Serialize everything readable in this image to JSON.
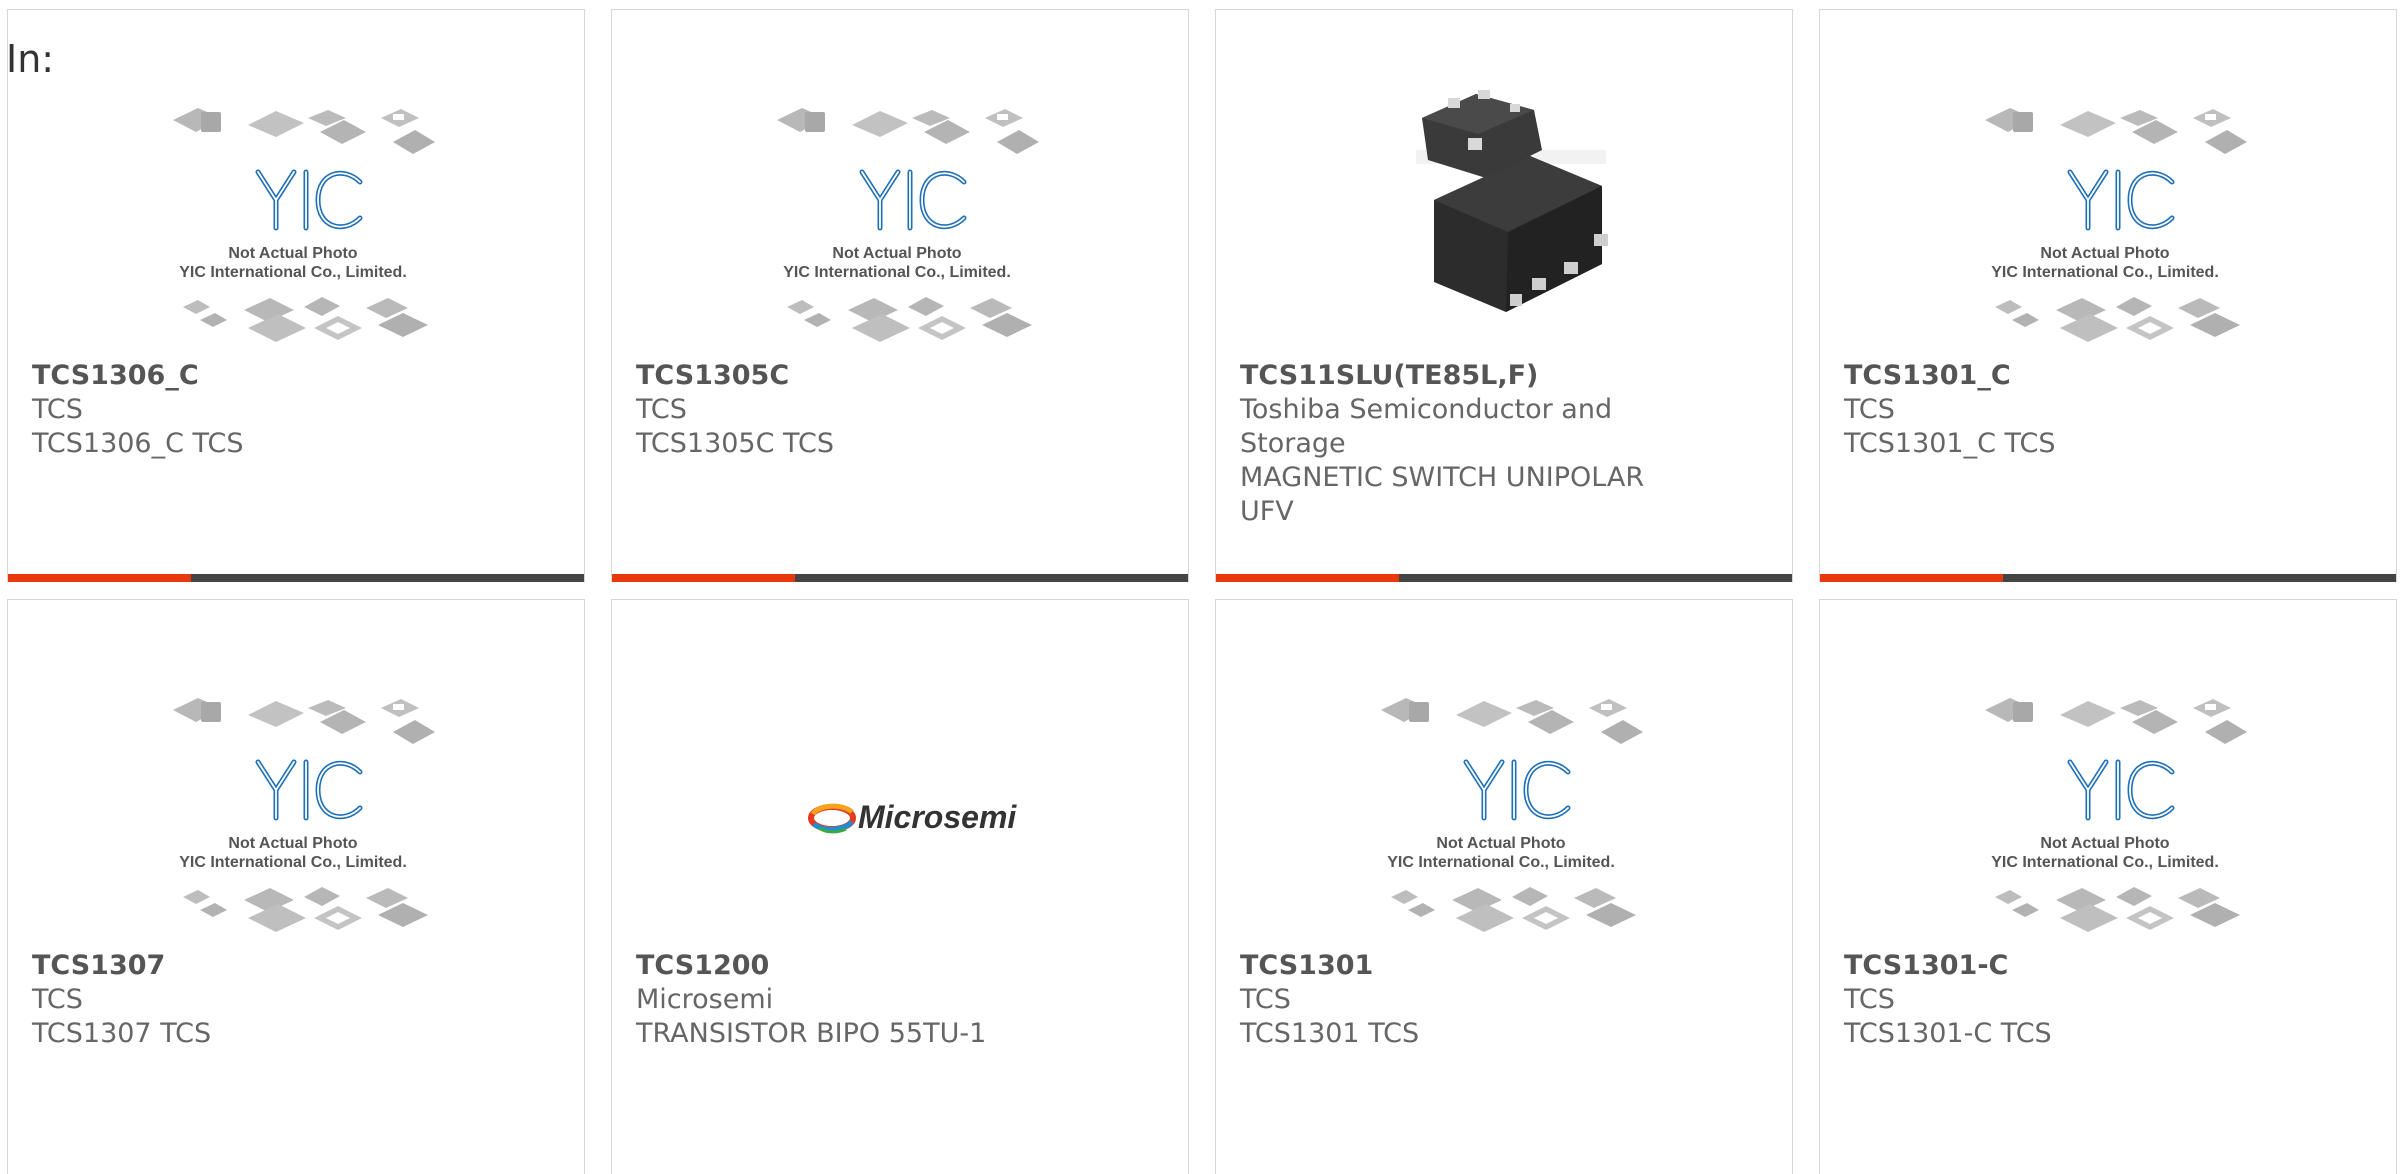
{
  "header": {
    "in_label": "In:"
  },
  "placeholder_photo": {
    "line1": "Not Actual Photo",
    "line2": "YIC International Co., Limited."
  },
  "logos": {
    "microsemi": "Microsemi"
  },
  "colors": {
    "stripe_accent": "#e8380d",
    "stripe_dark": "#444444",
    "yic_blue": "#1d6fb8",
    "border": "#d6d6d6"
  },
  "products": [
    {
      "part": "TCS1306_C",
      "maker": "TCS",
      "desc": "TCS1306_C TCS",
      "image": "yic-placeholder"
    },
    {
      "part": "TCS1305C",
      "maker": "TCS",
      "desc": "TCS1305C TCS",
      "image": "yic-placeholder"
    },
    {
      "part": "TCS11SLU(TE85L,F)",
      "maker": "Toshiba Semiconductor and Storage",
      "desc": "MAGNETIC SWITCH UNIPOLAR UFV",
      "image": "ufv-chip-photo"
    },
    {
      "part": "TCS1301_C",
      "maker": "TCS",
      "desc": "TCS1301_C TCS",
      "image": "yic-placeholder"
    },
    {
      "part": "TCS1307",
      "maker": "TCS",
      "desc": "TCS1307 TCS",
      "image": "yic-placeholder"
    },
    {
      "part": "TCS1200",
      "maker": "Microsemi",
      "desc": "TRANSISTOR BIPO 55TU-1",
      "image": "microsemi-logo"
    },
    {
      "part": "TCS1301",
      "maker": "TCS",
      "desc": "TCS1301 TCS",
      "image": "yic-placeholder"
    },
    {
      "part": "TCS1301-C",
      "maker": "TCS",
      "desc": "TCS1301-C TCS",
      "image": "yic-placeholder"
    }
  ]
}
